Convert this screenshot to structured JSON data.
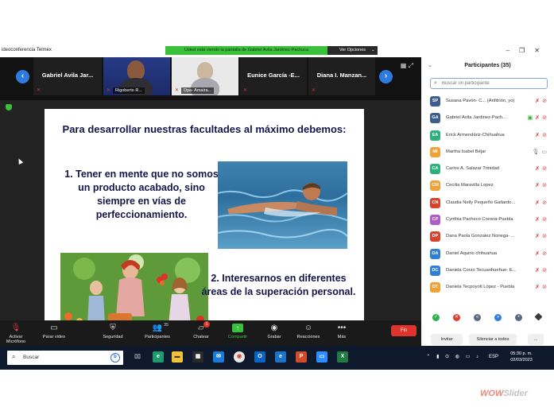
{
  "window": {
    "title": "ideoconferencia Telmex",
    "share_banner": "Usted está viendo la pantalla de Gabriel Avila Jardinez-Pachuca",
    "view_options": "Ver Opciones"
  },
  "strip": {
    "tiles": [
      {
        "name": "Gabriel Avila Jar...",
        "type": "name"
      },
      {
        "label": "Rigoberto R...",
        "type": "video"
      },
      {
        "label": "Dpa- Amaira...",
        "type": "video"
      },
      {
        "name": "Eunice García -E...",
        "type": "name"
      },
      {
        "name": "Diana I. Manzan...",
        "type": "name"
      }
    ]
  },
  "slide": {
    "title": "Para desarrollar nuestras facultades al máximo debemos:",
    "point1": "1. Tener en mente que no somos un producto acabado, sino siempre en vías de perfeccionamiento.",
    "point2": "2. Interesarnos en diferentes áreas de la superación personal."
  },
  "toolbar": {
    "mic": "Activar Micrófono",
    "video": "Parar video",
    "security": "Seguridad",
    "participants": "Participantes",
    "participants_count": "35",
    "chat": "Chatear",
    "chat_badge": "1",
    "share": "Compartir",
    "record": "Grabar",
    "reactions": "Reacciones",
    "more": "Más",
    "end": "Fin"
  },
  "panel": {
    "header": "Participantes (35)",
    "search_placeholder": "Buscar un participante",
    "participants": [
      {
        "initials": "SP",
        "name": "Susana Pavón- C...   (Anfitrión, yo)",
        "color": "#3b5d8f"
      },
      {
        "initials": "GA",
        "name": "Gabriel Avila Jardinez-Pach...",
        "color": "#3b5d8f"
      },
      {
        "initials": "EA",
        "name": "Erick Armendáriz-Chihuahua",
        "color": "#2eb07a"
      },
      {
        "initials": "MI",
        "name": "Martha Isabel Béjar",
        "color": "#f0a23a"
      },
      {
        "initials": "CA",
        "name": "Carlos A. Salazar Trinidad",
        "color": "#2eb07a"
      },
      {
        "initials": "CM",
        "name": "Cecilia Maravilla Lopez",
        "color": "#f0a23a"
      },
      {
        "initials": "CN",
        "name": "Claudia Nelly Pequeño Gallardo...",
        "color": "#d9432e"
      },
      {
        "initials": "CP",
        "name": "Cynthia Pacheco Corona-Puebla",
        "color": "#b05acb"
      },
      {
        "initials": "DP",
        "name": "Dana Paola Gonzalez Noriega- ...",
        "color": "#d9432e"
      },
      {
        "initials": "DA",
        "name": "Daniel Aquino chihuahua",
        "color": "#2f7fd6"
      },
      {
        "initials": "DC",
        "name": "Daniela Corzo Tecuanhuehue- E...",
        "color": "#2f7fd6"
      },
      {
        "initials": "DT",
        "name": "Daniela Tecpoyotl López - Puebla",
        "color": "#f0a23a"
      }
    ],
    "invite": "Invitar",
    "mute_all": "Silenciar a todos",
    "more": "..."
  },
  "taskbar": {
    "search": "Buscar",
    "language": "ESP",
    "time": "05:30 p. m.",
    "date": "02/03/2023"
  },
  "watermark": {
    "wow": "WOW",
    "slider": "Slider"
  }
}
